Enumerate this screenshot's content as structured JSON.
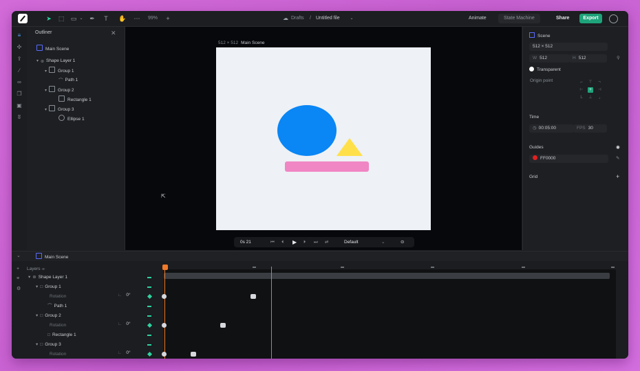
{
  "toolbar": {
    "zoom": "99%",
    "drafts": "Drafts",
    "separator": "/",
    "file_name": "Untitled file",
    "animate_tab": "Animate",
    "state_machine_tab": "State Machine",
    "share": "Share",
    "export": "Export"
  },
  "outliner": {
    "title": "Outliner",
    "items": [
      {
        "label": "Main Scene"
      },
      {
        "label": "Shape Layer 1"
      },
      {
        "label": "Group 1"
      },
      {
        "label": "Path 1"
      },
      {
        "label": "Group 2"
      },
      {
        "label": "Rectangle 1"
      },
      {
        "label": "Group 3"
      },
      {
        "label": "Ellipse 1"
      }
    ]
  },
  "canvas": {
    "size_label": "512 × 512",
    "scene_label": "Main Scene",
    "playbar": {
      "time": "0s 21",
      "preset": "Default"
    },
    "colors": {
      "circle": "#0a86f5",
      "triangle": "#ffe04a",
      "bar": "#f086c4",
      "artboard": "#eef1f5"
    }
  },
  "properties": {
    "scene_title": "Scene",
    "size_select": "512 × 512",
    "width_label": "W",
    "width": "512",
    "height_label": "H",
    "height": "512",
    "background": "Transparent",
    "origin_label": "Origin point",
    "time_title": "Time",
    "duration": "00:05:00",
    "fps_label": "FPS",
    "fps": "30",
    "guides_title": "Guides",
    "guide_color": "FF0000",
    "grid_title": "Grid"
  },
  "timeline": {
    "scene": "Main Scene",
    "layers_label": "Layers",
    "rows": [
      {
        "label": "Shape Layer 1"
      },
      {
        "label": "Group 1"
      },
      {
        "label": "Rotation",
        "value": "0°"
      },
      {
        "label": "Path 1"
      },
      {
        "label": "Group 2"
      },
      {
        "label": "Rotation",
        "value": "0°"
      },
      {
        "label": "Rectangle 1"
      },
      {
        "label": "Group 3"
      },
      {
        "label": "Rotation",
        "value": "0°"
      }
    ]
  }
}
